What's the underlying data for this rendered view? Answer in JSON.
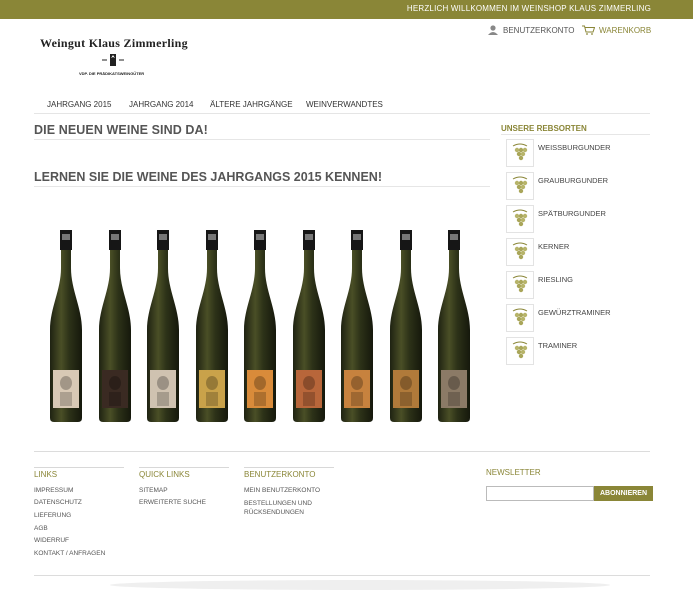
{
  "topbar": {
    "welcome": "HERZLICH WILLKOMMEN IM WEINSHOP KLAUS ZIMMERLING"
  },
  "logo": {
    "name": "Weingut Klaus Zimmerling",
    "subtitle": "VDP. DIE PRÄDIKATSWEINGÜTER"
  },
  "header": {
    "account": "BENUTZERKONTO",
    "cart": "WARENKORB"
  },
  "nav": [
    {
      "label": "JAHRGANG 2015"
    },
    {
      "label": "JAHRGANG 2014"
    },
    {
      "label": "ÄLTERE JAHRGÄNGE"
    },
    {
      "label": "WEINVERWANDTES"
    }
  ],
  "main": {
    "heading1": "DIE NEUEN WEINE SIND DA!",
    "heading2": "LERNEN SIE DIE WEINE DES JAHRGANGS 2015 KENNEN!",
    "bottle_count": 9
  },
  "sidebar": {
    "title": "UNSERE REBSORTEN",
    "items": [
      {
        "label": "WEISSBURGUNDER"
      },
      {
        "label": "GRAUBURGUNDER"
      },
      {
        "label": "SPÄTBURGUNDER"
      },
      {
        "label": "KERNER"
      },
      {
        "label": "RIESLING"
      },
      {
        "label": "GEWÜRZTRAMINER"
      },
      {
        "label": "TRAMINER"
      }
    ]
  },
  "footer": {
    "links": {
      "title": "LINKS",
      "items": [
        "IMPRESSUM",
        "DATENSCHUTZ",
        "LIEFERUNG",
        "AGB",
        "WIDERRUF",
        "KONTAKT / ANFRAGEN"
      ]
    },
    "quick": {
      "title": "QUICK LINKS",
      "items": [
        "SITEMAP",
        "ERWEITERTE SUCHE"
      ]
    },
    "account": {
      "title": "BENUTZERKONTO",
      "items": [
        "MEIN BENUTZERKONTO",
        "BESTELLUNGEN UND",
        "RÜCKSENDUNGEN"
      ]
    },
    "newsletter": {
      "title": "NEWSLETTER",
      "button": "ABONNIEREN",
      "input_value": ""
    }
  },
  "colors": {
    "accent": "#8a8637",
    "text": "#444444",
    "wine": "#c9b36a"
  },
  "icons": {
    "account": "user-icon",
    "cart": "cart-icon",
    "grape": "grape-icon"
  }
}
